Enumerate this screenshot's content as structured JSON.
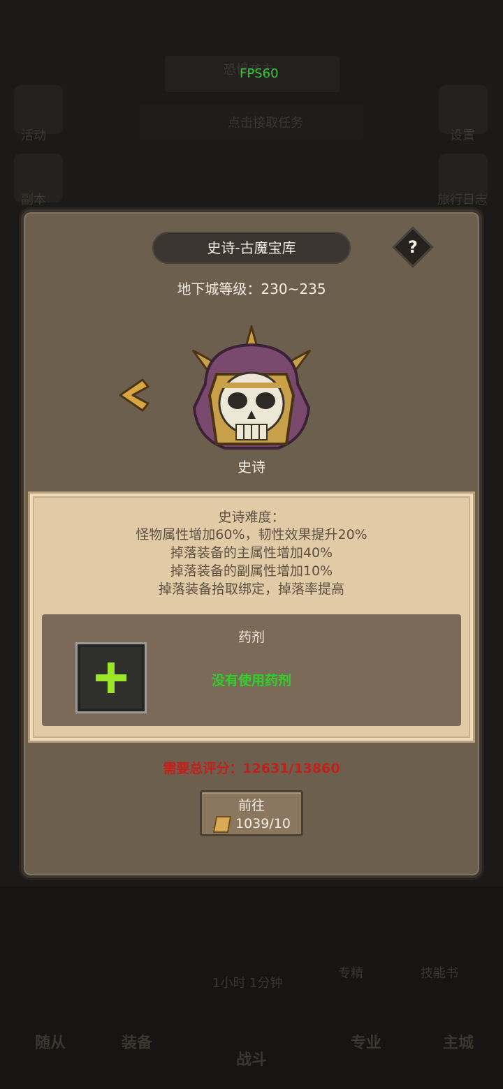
{
  "background": {
    "fps": "FPS60",
    "banner": "恐惧袭击",
    "task": "点击接取任务",
    "left_labels": [
      "活动",
      "副本"
    ],
    "right_labels": [
      "设置",
      "旅行日志"
    ],
    "timer": "1小时 1分钟",
    "mid_labels": [
      "专精",
      "技能书"
    ],
    "nav": [
      "随从",
      "装备",
      "战斗",
      "专业",
      "主城"
    ]
  },
  "dialog": {
    "title": "史诗-古魔宝库",
    "help": "?",
    "dungeon_level": "地下城等级：230~235",
    "difficulty_name": "史诗",
    "description": [
      "史诗难度：",
      "怪物属性增加60%，韧性效果提升20%",
      "掉落装备的主属性增加40%",
      "掉落装备的副属性增加10%",
      "掉落装备拾取绑定，掉落率提高"
    ],
    "potion_title": "药剂",
    "potion_status": "没有使用药剂",
    "required_score": "需要总评分：12631/13860",
    "go_button": "前往",
    "go_cost": "1039/10"
  },
  "colors": {
    "accent_green": "#2fd02a",
    "warning_red": "#c3201b",
    "parchment": "#e0cba6"
  }
}
